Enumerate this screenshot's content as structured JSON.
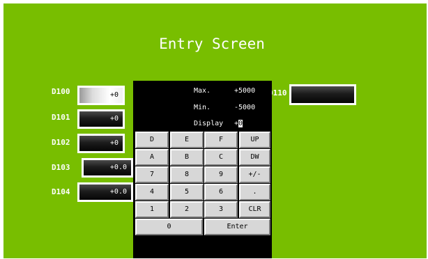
{
  "title": "Entry Screen",
  "fields": [
    {
      "label": "D100",
      "value": "+0"
    },
    {
      "label": "D101",
      "value": "+0"
    },
    {
      "label": "D102",
      "value": "+0"
    },
    {
      "label": "D103",
      "value": "+0.0"
    },
    {
      "label": "D104",
      "value": "+0.0"
    },
    {
      "label": "D110",
      "value": ""
    }
  ],
  "keypad": {
    "max_label": "Max.",
    "max_value": "+5000",
    "min_label": "Min.",
    "min_value": "-5000",
    "display_label": "Display",
    "display_sign": "+",
    "display_cursor": "0",
    "keys": {
      "d": "D",
      "e": "E",
      "f": "F",
      "up": "UP",
      "a": "A",
      "b": "B",
      "c": "C",
      "dw": "DW",
      "k7": "7",
      "k8": "8",
      "k9": "9",
      "plusminus": "+/-",
      "k4": "4",
      "k5": "5",
      "k6": "6",
      "dot": ".",
      "k1": "1",
      "k2": "2",
      "k3": "3",
      "clr": "CLR",
      "k0": "0",
      "enter": "Enter"
    }
  },
  "colors": {
    "background": "#78be00",
    "panel": "#000000",
    "key": "#d7d7d7"
  }
}
